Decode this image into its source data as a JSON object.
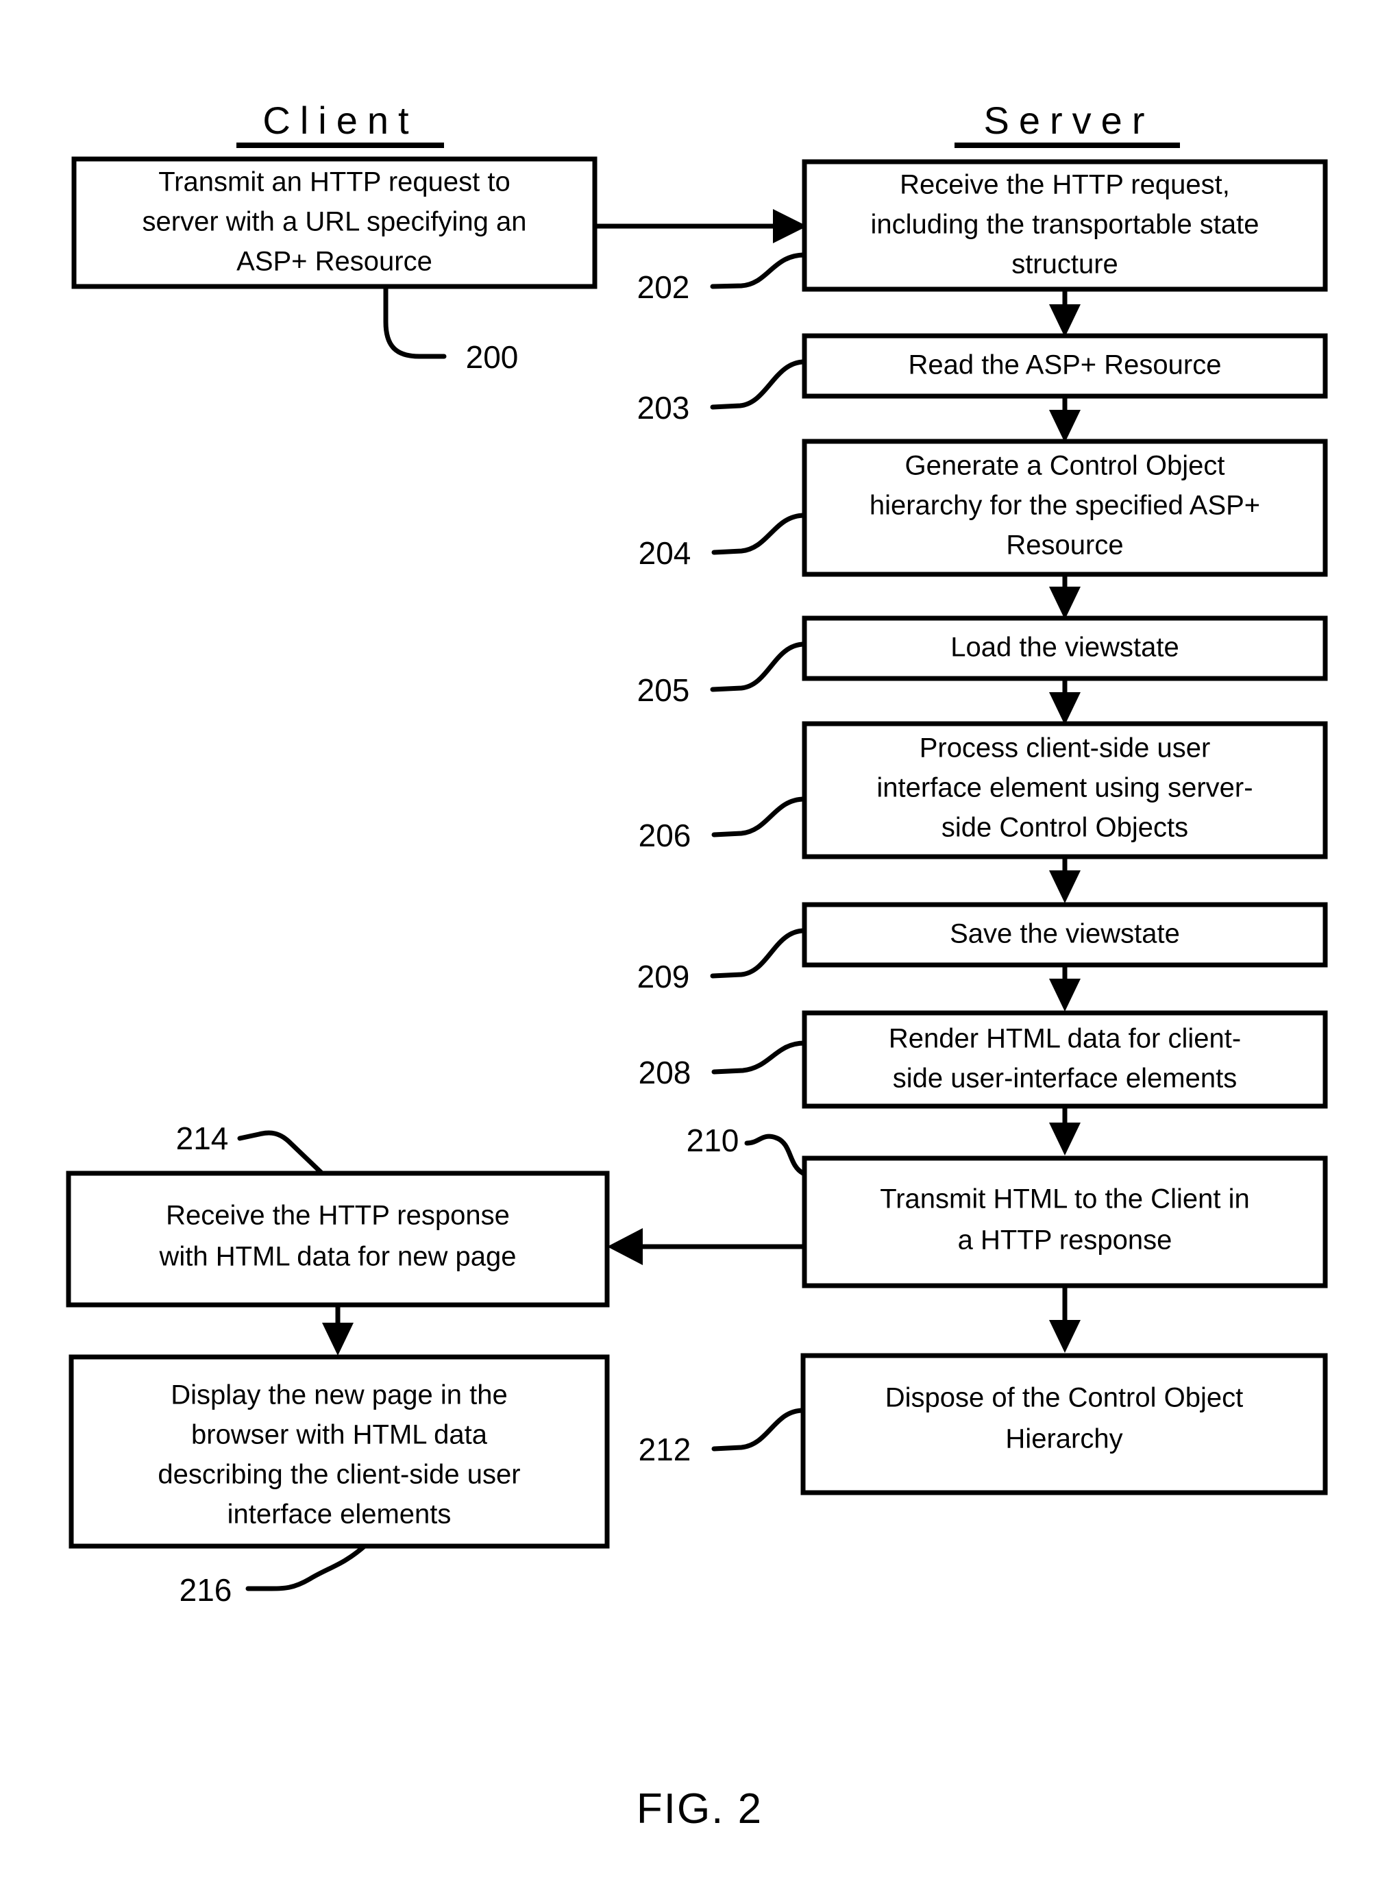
{
  "figure": {
    "caption": "FIG. 2",
    "columns": {
      "client": "Client",
      "server": "Server"
    }
  },
  "nodes": {
    "n200": {
      "ref": "200",
      "column": "client",
      "lines": [
        "Transmit an HTTP request to",
        "server with a URL specifying an",
        "ASP+ Resource"
      ]
    },
    "n202": {
      "ref": "202",
      "column": "server",
      "lines": [
        "Receive the HTTP request,",
        "including the transportable state",
        "structure"
      ]
    },
    "n203": {
      "ref": "203",
      "column": "server",
      "lines": [
        "Read the ASP+ Resource"
      ]
    },
    "n204": {
      "ref": "204",
      "column": "server",
      "lines": [
        "Generate a Control Object",
        "hierarchy for the specified ASP+",
        "Resource"
      ]
    },
    "n205": {
      "ref": "205",
      "column": "server",
      "lines": [
        "Load the viewstate"
      ]
    },
    "n206": {
      "ref": "206",
      "column": "server",
      "lines": [
        "Process client-side user",
        "interface element using server-",
        "side Control Objects"
      ]
    },
    "n209": {
      "ref": "209",
      "column": "server",
      "lines": [
        "Save the viewstate"
      ]
    },
    "n208": {
      "ref": "208",
      "column": "server",
      "lines": [
        "Render HTML data for client-",
        "side user-interface elements"
      ]
    },
    "n210": {
      "ref": "210",
      "column": "server",
      "lines": [
        "Transmit HTML to the Client in",
        "a HTTP response"
      ]
    },
    "n212": {
      "ref": "212",
      "column": "server",
      "lines": [
        "Dispose of the Control Object",
        "Hierarchy"
      ]
    },
    "n214": {
      "ref": "214",
      "column": "client",
      "lines": [
        "Receive the HTTP response",
        "with HTML data for new page"
      ]
    },
    "n216": {
      "ref": "216",
      "column": "client",
      "lines": [
        "Display the new page in the",
        "browser with HTML data",
        "describing the client-side user",
        "interface elements"
      ]
    }
  },
  "colors": {
    "ink": "#000000",
    "paper": "#ffffff"
  }
}
